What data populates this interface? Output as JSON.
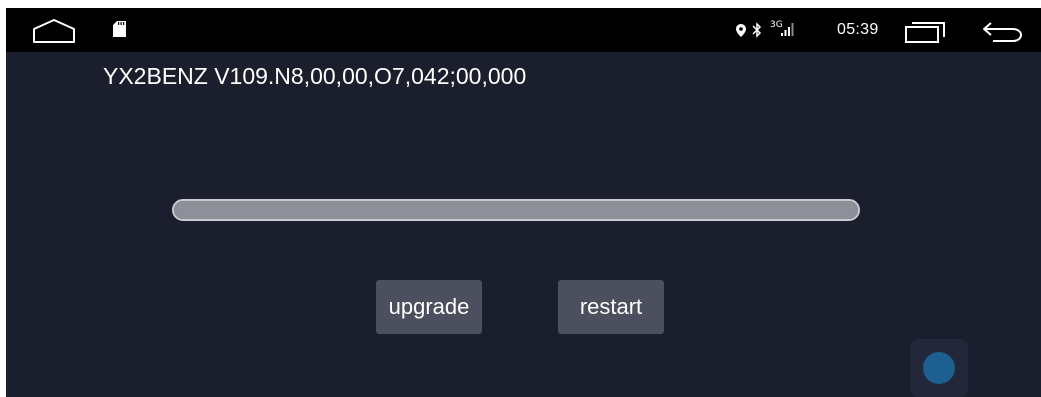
{
  "status_bar": {
    "network_type": "3G",
    "time": "05:39",
    "icons": [
      "home-icon",
      "sd-card-icon",
      "location-icon",
      "bluetooth-icon",
      "signal-icon",
      "recents-icon",
      "back-icon"
    ]
  },
  "main": {
    "version_text": "YX2BENZ V109.N8,00,00,O7,042;00,000",
    "progress_fraction": 1.0,
    "buttons": {
      "upgrade_label": "upgrade",
      "restart_label": "restart"
    }
  },
  "colors": {
    "background": "#1b1f2d",
    "status_bar": "#000000",
    "button": "#4b4f5e",
    "progress_fill": "#8e9099",
    "floating_dot": "#1d5f8f"
  }
}
